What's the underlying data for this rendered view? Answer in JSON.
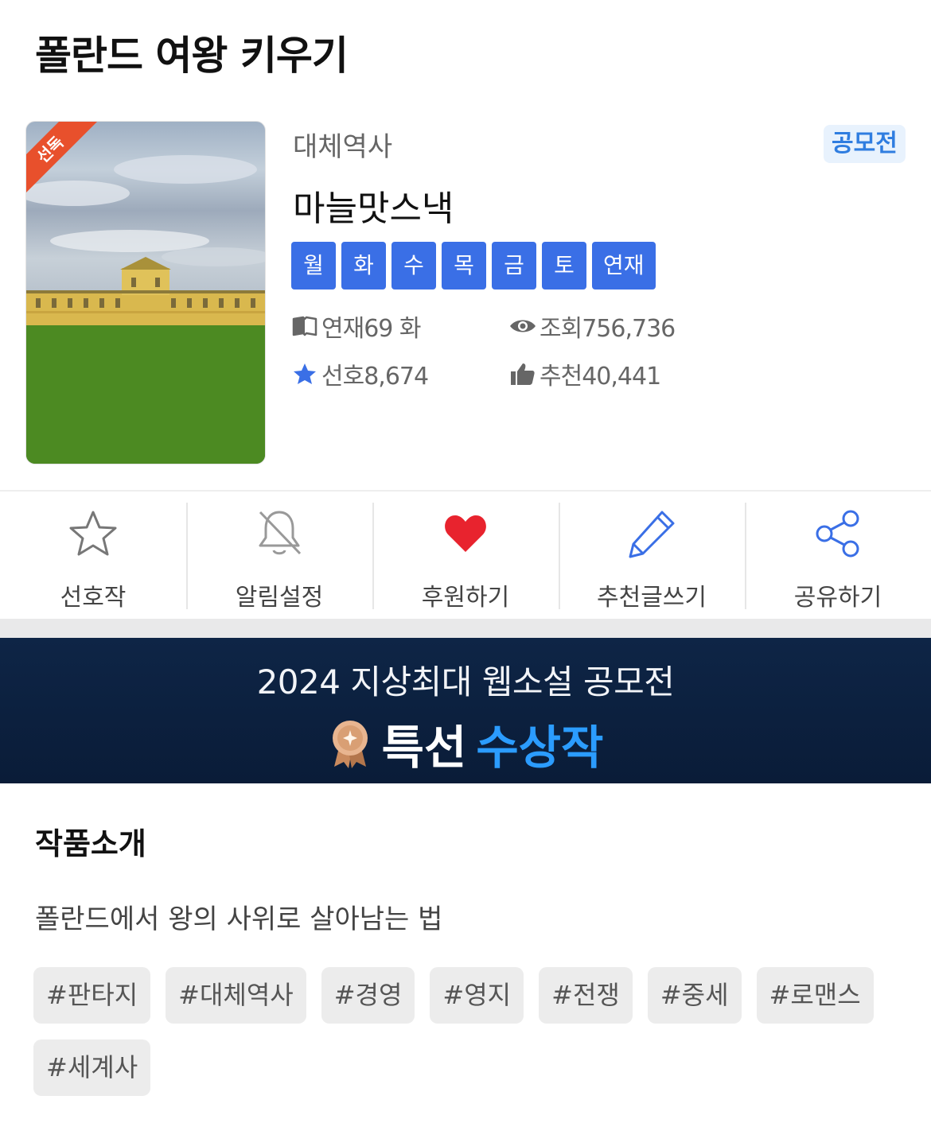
{
  "title": "폴란드 여왕 키우기",
  "cover": {
    "corner_badge": "선독"
  },
  "genre": "대체역사",
  "contest_badge": "공모전",
  "author": "마늘맛스낵",
  "days": [
    "월",
    "화",
    "수",
    "목",
    "금",
    "토",
    "연재"
  ],
  "stats": {
    "episodes": "연재69 화",
    "views": "조회756,736",
    "favorites": "선호8,674",
    "recommends": "추천40,441"
  },
  "actions": {
    "favorite": "선호작",
    "alarm": "알림설정",
    "support": "후원하기",
    "review": "추천글쓰기",
    "share": "공유하기"
  },
  "banner": {
    "line1": "2024 지상최대 웹소설 공모전",
    "award_white": "특선",
    "award_blue": "수상작"
  },
  "intro_section": {
    "title": "작품소개",
    "text": "폴란드에서 왕의 사위로 살아남는 법"
  },
  "tags": [
    "#판타지",
    "#대체역사",
    "#경영",
    "#영지",
    "#전쟁",
    "#중세",
    "#로맨스",
    "#세계사"
  ],
  "colors": {
    "day_chip": "#3a6fe6",
    "contest_badge_text": "#2f7de0",
    "heart": "#e8232e",
    "pencil": "#3a6fe6",
    "share": "#3a6fe6",
    "banner_bg": "#0e2546",
    "award_blue": "#2b9cff"
  },
  "icons": {
    "episodes": "book-icon",
    "views": "eye-icon",
    "favorites": "star-icon",
    "recommends": "thumbs-up-icon",
    "favorite": "star-outline-icon",
    "alarm": "bell-off-icon",
    "support": "heart-icon",
    "review": "pencil-icon",
    "share": "share-icon",
    "medal": "medal-icon"
  }
}
